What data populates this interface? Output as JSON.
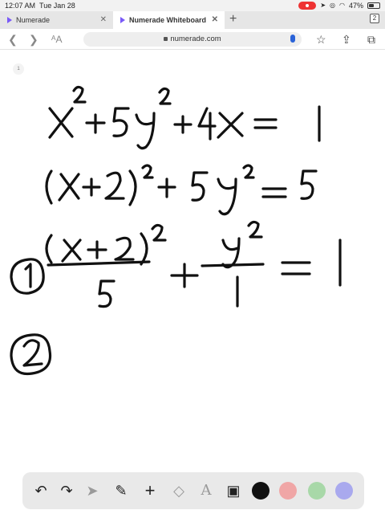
{
  "status_bar": {
    "time": "12:07 AM",
    "date": "Tue Jan 28",
    "battery": "47%"
  },
  "tabs": [
    {
      "label": "Numerade",
      "active": false
    },
    {
      "label": "Numerade Whiteboard",
      "active": true
    }
  ],
  "tab_count": "2",
  "url": "numerade.com",
  "page_indicator": "1",
  "whiteboard_lines": [
    "x^2 + 5y^2 + 4x = 1",
    "(x+2)^2 + 5y^2 = 5",
    "(x+2)^2 / 5 + y^2 / 1 = 1"
  ],
  "step_markers": [
    "1",
    "2"
  ],
  "tools": [
    "undo-icon",
    "redo-icon",
    "select-icon",
    "pen-icon",
    "add-icon",
    "eraser-icon",
    "text-icon",
    "image-icon"
  ],
  "colors": {
    "black": "#111111",
    "pink": "#f0a6a6",
    "green": "#a8d8a8",
    "purple": "#a9a9ee",
    "brand": "#7a5af8"
  }
}
